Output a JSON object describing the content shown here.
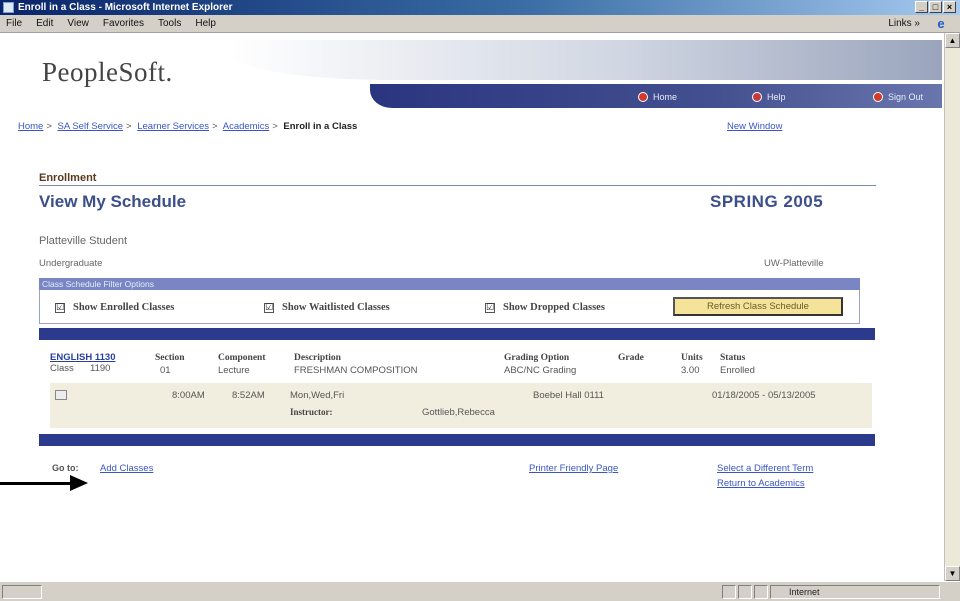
{
  "window": {
    "title": "Enroll in a Class - Microsoft Internet Explorer",
    "menus": [
      "File",
      "Edit",
      "View",
      "Favorites",
      "Tools",
      "Help"
    ],
    "links_label": "Links »",
    "status_zone": "Internet"
  },
  "header": {
    "brand": "PeopleSoft.",
    "nav": {
      "home": "Home",
      "help": "Help",
      "signout": "Sign Out"
    }
  },
  "breadcrumb": {
    "items": [
      "Home",
      "SA Self Service",
      "Learner Services",
      "Academics"
    ],
    "current": "Enroll in a Class",
    "new_window": "New Window"
  },
  "page": {
    "section": "Enrollment",
    "title": "View My Schedule",
    "term": "SPRING 2005",
    "school": "Platteville Student",
    "career": "Undergraduate",
    "institution": "UW-Platteville"
  },
  "filter": {
    "heading": "Class Schedule Filter Options",
    "show_enrolled": "Show Enrolled Classes",
    "show_waitlisted": "Show Waitlisted Classes",
    "show_dropped": "Show Dropped Classes",
    "checked": "☑",
    "refresh": "Refresh Class Schedule"
  },
  "table": {
    "headers": {
      "section": "Section",
      "component": "Component",
      "description": "Description",
      "grading": "Grading Option",
      "grade": "Grade",
      "units": "Units",
      "status": "Status"
    },
    "class": {
      "code": "ENGLISH 1130",
      "class_label": "Class",
      "class_nbr": "1190",
      "section": "01",
      "component": "Lecture",
      "description": "FRESHMAN COMPOSITION",
      "grading": "ABC/NC Grading",
      "units": "3.00",
      "status": "Enrolled"
    },
    "meeting": {
      "start": "8:00AM",
      "end": "8:52AM",
      "days": "Mon,Wed,Fri",
      "room": "Boebel Hall 0111",
      "dates": "01/18/2005 - 05/13/2005",
      "instructor_label": "Instructor:",
      "instructor": "Gottlieb,Rebecca"
    }
  },
  "goto": {
    "label": "Go to:",
    "add_classes": "Add Classes",
    "printer_friendly": "Printer Friendly Page",
    "select_term": "Select a Different Term",
    "return": "Return to Academics"
  }
}
